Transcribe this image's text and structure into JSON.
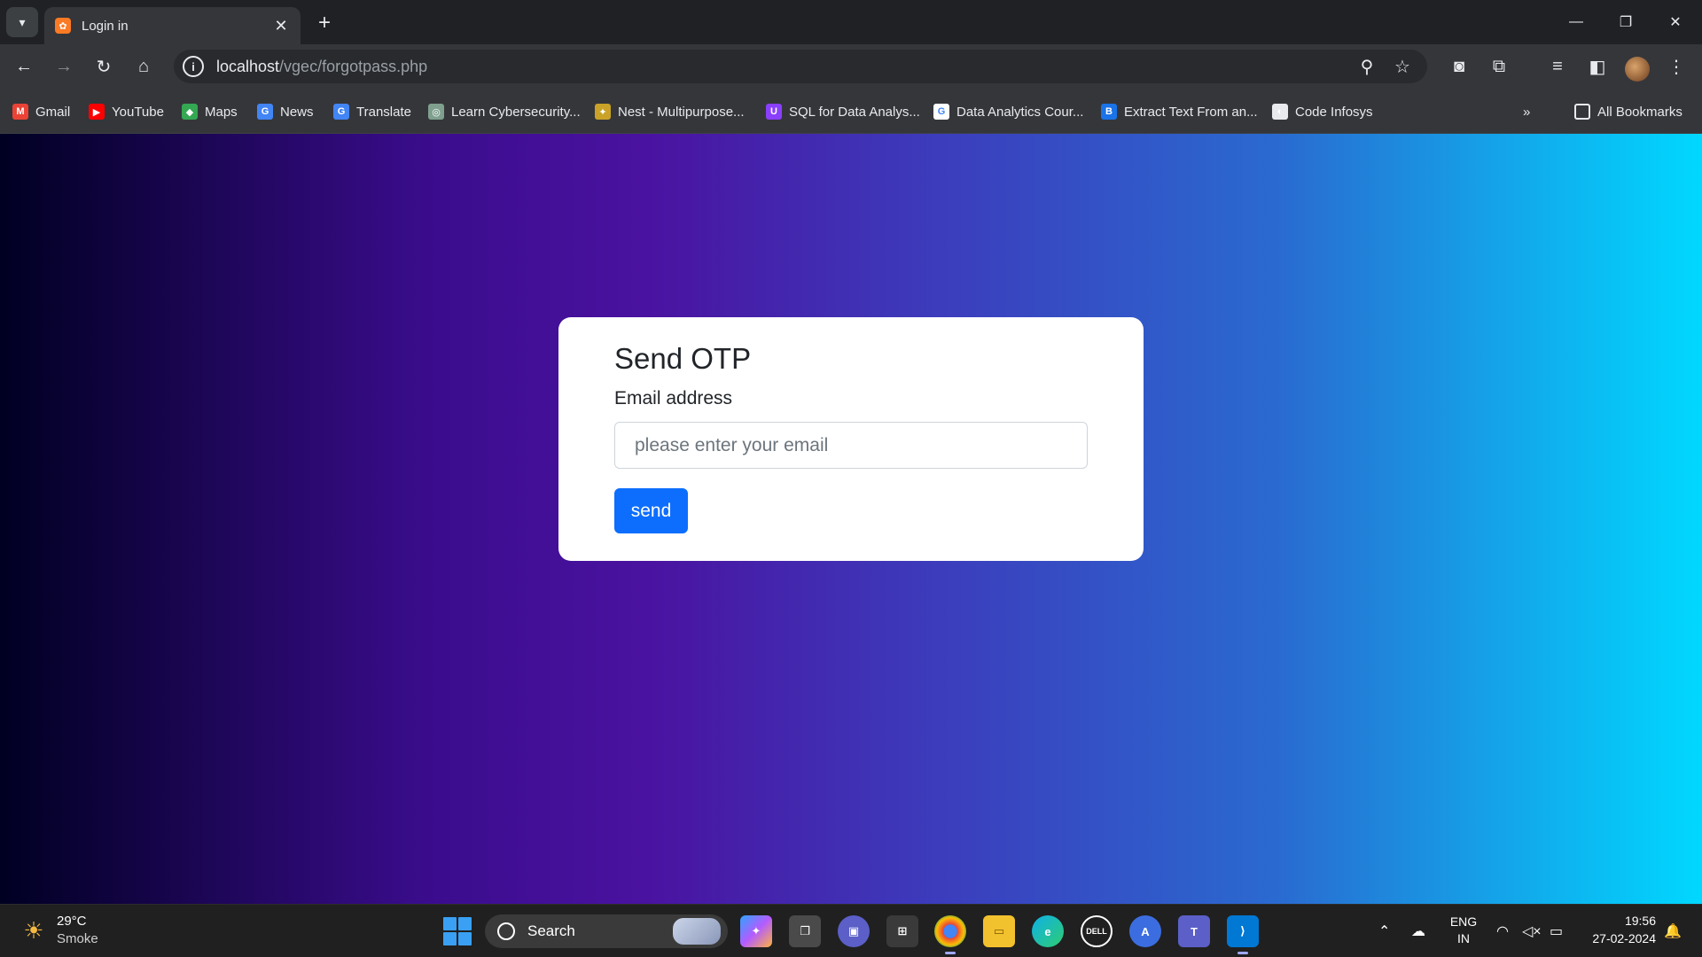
{
  "browser": {
    "tab_title": "Login in",
    "url_host": "localhost",
    "url_path": "/vgec/forgotpass.php"
  },
  "bookmarks": [
    {
      "label": "Gmail",
      "icon": "gmail-icon",
      "color": "#ea4335",
      "glyph": "M"
    },
    {
      "label": "YouTube",
      "icon": "youtube-icon",
      "color": "#ff0000",
      "glyph": "▶"
    },
    {
      "label": "Maps",
      "icon": "maps-icon",
      "color": "#34a853",
      "glyph": "◆"
    },
    {
      "label": "News",
      "icon": "news-icon",
      "color": "#4285f4",
      "glyph": "G"
    },
    {
      "label": "Translate",
      "icon": "translate-icon",
      "color": "#4285f4",
      "glyph": "G"
    },
    {
      "label": "Learn Cybersecurity...",
      "icon": "cybersecurity-icon",
      "color": "#7fa08e",
      "glyph": "◎"
    },
    {
      "label": "Nest - Multipurpose...",
      "icon": "nest-icon",
      "color": "#c9a227",
      "glyph": "✦"
    },
    {
      "label": "SQL for Data Analys...",
      "icon": "sql-icon",
      "color": "#8a3ffc",
      "glyph": "U"
    },
    {
      "label": "Data Analytics Cour...",
      "icon": "google-icon",
      "color": "#ffffff",
      "glyph": "G"
    },
    {
      "label": "Extract Text From an...",
      "icon": "extract-text-icon",
      "color": "#1a73e8",
      "glyph": "B"
    },
    {
      "label": "Code Infosys",
      "icon": "code-infosys-icon",
      "color": "#e8eaed",
      "glyph": "◐"
    }
  ],
  "bookmarks_all_label": "All Bookmarks",
  "form": {
    "title": "Send OTP",
    "email_label": "Email address",
    "email_placeholder": "please enter your email",
    "email_value": "",
    "send_label": "send"
  },
  "taskbar": {
    "weather_temp": "29°C",
    "weather_desc": "Smoke",
    "search_label": "Search",
    "lang_line1": "ENG",
    "lang_line2": "IN",
    "time": "19:56",
    "date": "27-02-2024"
  },
  "colors": {
    "primary_button": "#0d6efd",
    "gradient_start": "#000022",
    "gradient_mid": "#4a12a0",
    "gradient_end": "#00d8ff"
  }
}
